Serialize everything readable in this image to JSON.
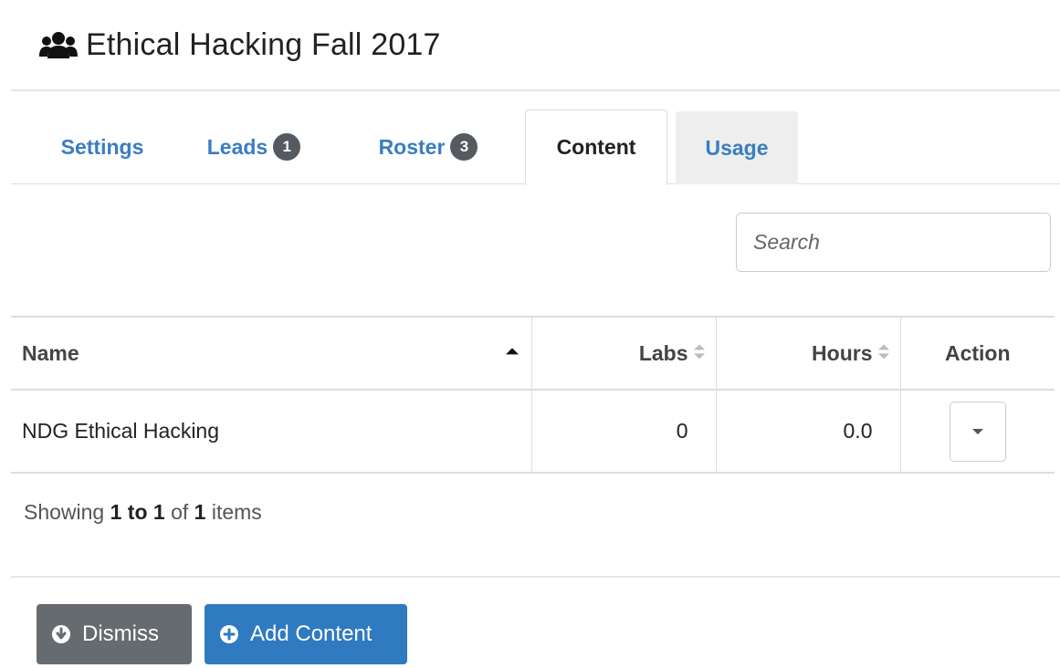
{
  "header": {
    "title": "Ethical Hacking Fall 2017",
    "icon": "users-icon"
  },
  "tabs": [
    {
      "label": "Settings"
    },
    {
      "label": "Leads",
      "badge": "1"
    },
    {
      "label": "Roster",
      "badge": "3"
    },
    {
      "label": "Content",
      "active": true
    },
    {
      "label": "Usage"
    }
  ],
  "search": {
    "placeholder": "Search",
    "value": ""
  },
  "table": {
    "columns": [
      {
        "label": "Name",
        "sort": "asc"
      },
      {
        "label": "Labs",
        "sort": "none"
      },
      {
        "label": "Hours",
        "sort": "none"
      },
      {
        "label": "Action"
      }
    ],
    "rows": [
      {
        "name": "NDG Ethical Hacking",
        "labs": "0",
        "hours": "0.0"
      }
    ]
  },
  "summary": {
    "prefix": "Showing",
    "range": "1 to 1",
    "of": "of",
    "total": "1",
    "suffix": "items"
  },
  "buttons": {
    "dismiss_label": "Dismiss",
    "add_content_label": "Add Content"
  },
  "colors": {
    "link_blue": "#3a7dc2",
    "primary_blue": "#2f7ac1",
    "dismiss_gray": "#666b70",
    "badge_gray": "#555a60"
  }
}
